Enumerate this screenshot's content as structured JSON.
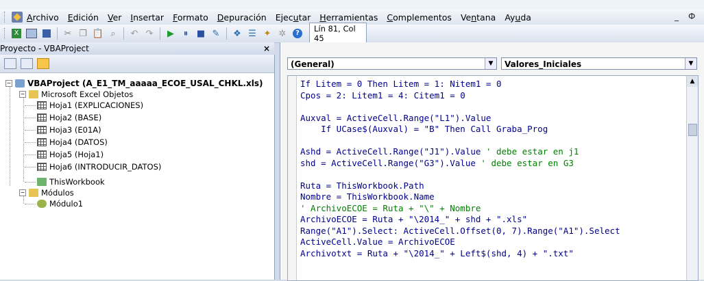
{
  "menu": [
    "Archivo",
    "Edición",
    "Ver",
    "Insertar",
    "Formato",
    "Depuración",
    "Ejecutar",
    "Herramientas",
    "Complementos",
    "Ventana",
    "Ayuda"
  ],
  "menu_underline": [
    "A",
    "E",
    "V",
    "I",
    "F",
    "D",
    "u",
    "H",
    "C",
    "n",
    "u"
  ],
  "window_controls": {
    "minimize": "_",
    "restore": "Ф"
  },
  "toolbar": {
    "position_status": "Lín 81, Col 45"
  },
  "project_panel": {
    "title": "Proyecto - VBAProject",
    "close": "×",
    "root": "VBAProject (A_E1_TM_aaaaa_ECOE_USAL_CHKL.xls)",
    "folder_objects": "Microsoft Excel Objetos",
    "sheets": [
      "Hoja1 (EXPLICACIONES)",
      "Hoja2 (BASE)",
      "Hoja3 (E01A)",
      "Hoja4 (DATOS)",
      "Hoja5 (Hoja1)",
      "Hoja6 (INTRODUCIR_DATOS)"
    ],
    "workbook": "ThisWorkbook",
    "folder_modules": "Módulos",
    "module": "Módulo1"
  },
  "code_window": {
    "object_dropdown": "(General)",
    "procedure_dropdown": "Valores_Iniciales",
    "lines": [
      {
        "t": "If Litem = 0 Then Litem = 1: Nitem1 = 0",
        "c": false
      },
      {
        "t": "Cpos = 2: Litem1 = 4: Citem1 = 0",
        "c": false
      },
      {
        "t": "",
        "c": false
      },
      {
        "t": "Auxval = ActiveCell.Range(\"L1\").Value",
        "c": false
      },
      {
        "t": "    If UCase$(Auxval) = \"B\" Then Call Graba_Prog",
        "c": false
      },
      {
        "t": "",
        "c": false
      },
      {
        "t": "Ashd = ActiveCell.Range(\"J1\").Value ",
        "c": false,
        "comment": "' debe estar en j1"
      },
      {
        "t": "shd = ActiveCell.Range(\"G3\").Value ",
        "c": false,
        "comment": "' debe estar en G3"
      },
      {
        "t": "",
        "c": false
      },
      {
        "t": "Ruta = ThisWorkbook.Path",
        "c": false
      },
      {
        "t": "Nombre = ThisWorkbook.Name",
        "c": false
      },
      {
        "t": "' ArchivoECOE = Ruta + \"\\\" + Nombre",
        "c": true
      },
      {
        "t": "ArchivoECOE = Ruta + \"\\2014_\" + shd + \".xls\"",
        "c": false
      },
      {
        "t": "Range(\"A1\").Select: ActiveCell.Offset(0, 7).Range(\"A1\").Select",
        "c": false
      },
      {
        "t": "ActiveCell.Value = ArchivoECOE",
        "c": false
      },
      {
        "t": "Archivotxt = Ruta + \"\\2014_\" + Left$(shd, 4) + \".txt\"",
        "c": false
      }
    ]
  }
}
